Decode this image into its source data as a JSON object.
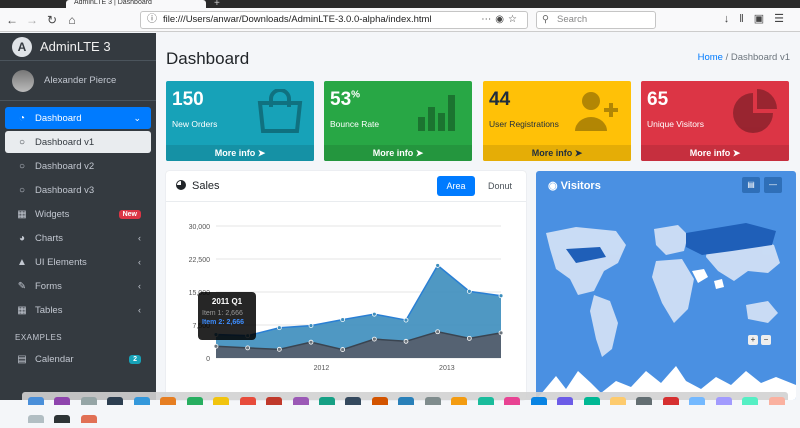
{
  "browser": {
    "tab_title": "AdminLTE 3 | Dashboard",
    "url": "file:///Users/anwar/Downloads/AdminLTE-3.0.0-alpha/index.html",
    "search_placeholder": "Search"
  },
  "sidebar": {
    "brand": "AdminLTE 3",
    "user": "Alexander Pierce",
    "items": [
      {
        "label": "Dashboard",
        "icon": "dashboard-icon",
        "state": "active"
      },
      {
        "label": "Dashboard v1",
        "icon": "circle-icon",
        "state": "sub-active"
      },
      {
        "label": "Dashboard v2",
        "icon": "circle-icon",
        "state": ""
      },
      {
        "label": "Dashboard v3",
        "icon": "circle-icon",
        "state": ""
      },
      {
        "label": "Widgets",
        "icon": "th-icon",
        "badge": "New"
      },
      {
        "label": "Charts",
        "icon": "pie-chart-icon"
      },
      {
        "label": "UI Elements",
        "icon": "tree-icon"
      },
      {
        "label": "Forms",
        "icon": "edit-icon"
      },
      {
        "label": "Tables",
        "icon": "table-icon"
      }
    ],
    "section_examples": "EXAMPLES",
    "calendar": {
      "label": "Calendar",
      "badge": "2"
    }
  },
  "header": {
    "title": "Dashboard",
    "breadcrumb_home": "Home",
    "breadcrumb_sep": "/",
    "breadcrumb_current": "Dashboard v1"
  },
  "stats": [
    {
      "value": "150",
      "suffix": "",
      "label": "New Orders",
      "more": "More info",
      "color": "#17a2b8"
    },
    {
      "value": "53",
      "suffix": "%",
      "label": "Bounce Rate",
      "more": "More info",
      "color": "#28a745"
    },
    {
      "value": "44",
      "suffix": "",
      "label": "User Registrations",
      "more": "More info",
      "color": "#ffc107"
    },
    {
      "value": "65",
      "suffix": "",
      "label": "Unique Visitors",
      "more": "More info",
      "color": "#dc3545"
    }
  ],
  "sales": {
    "title": "Sales",
    "tab_area": "Area",
    "tab_donut": "Donut",
    "tooltip": {
      "title": "2011 Q1",
      "item1": "Item 1: 2,666",
      "item2": "Item 2: 2,666"
    }
  },
  "visitors": {
    "title": "Visitors"
  },
  "chart_data": {
    "type": "area",
    "y_ticks": [
      "30,000",
      "22,500",
      "15,000",
      "7,500",
      "0"
    ],
    "x_ticks": [
      "2012",
      "2013"
    ],
    "ylim": [
      0,
      30000
    ],
    "series": [
      {
        "color": "#3c8dbc",
        "values": [
          2666,
          2778,
          4912,
          3767,
          6810,
          5670,
          4820,
          15073,
          10687,
          8432
        ]
      },
      {
        "color": "#4c5a6a",
        "values": [
          2666,
          2294,
          1969,
          3597,
          1914,
          4293,
          3795,
          5967,
          4460,
          5713
        ]
      }
    ],
    "accent": "#007bff"
  }
}
